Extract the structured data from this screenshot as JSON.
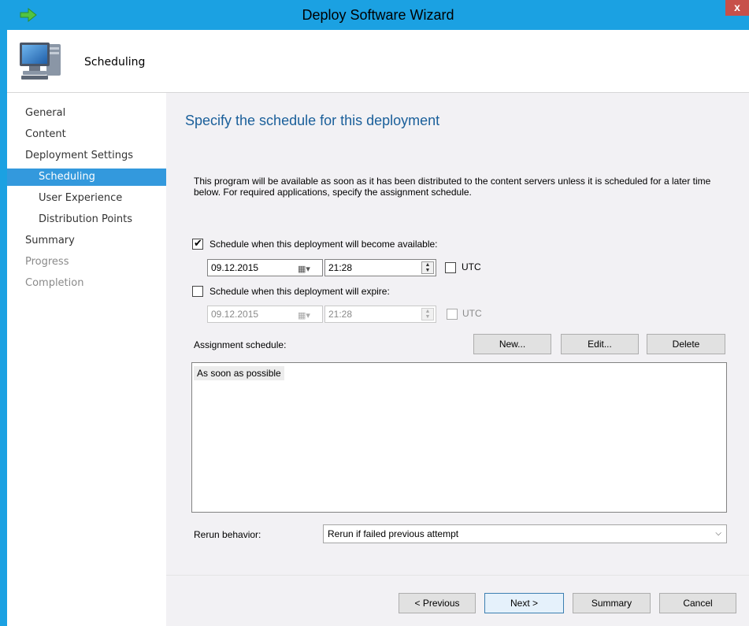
{
  "window": {
    "title": "Deploy Software Wizard",
    "close_label": "x"
  },
  "header": {
    "page_title": "Scheduling"
  },
  "nav": {
    "items": [
      {
        "label": "General"
      },
      {
        "label": "Content"
      },
      {
        "label": "Deployment Settings"
      },
      {
        "label": "Scheduling"
      },
      {
        "label": "User Experience"
      },
      {
        "label": "Distribution Points"
      },
      {
        "label": "Summary"
      },
      {
        "label": "Progress"
      },
      {
        "label": "Completion"
      }
    ]
  },
  "main": {
    "heading": "Specify the schedule for this deployment",
    "description": "This program will be available as soon as it has been distributed to the content servers unless it is scheduled for a later time below. For required applications, specify the assignment schedule.",
    "available": {
      "label": "Schedule when this deployment will become available:",
      "checked": true,
      "date": "09.12.2015",
      "time": "21:28",
      "utc_label": "UTC"
    },
    "expire": {
      "label": "Schedule when this deployment will expire:",
      "checked": false,
      "date": "09.12.2015",
      "time": "21:28",
      "utc_label": "UTC"
    },
    "assignment": {
      "label": "Assignment schedule:",
      "new_label": "New...",
      "edit_label": "Edit...",
      "delete_label": "Delete",
      "items": [
        "As soon as possible"
      ]
    },
    "rerun": {
      "label": "Rerun behavior:",
      "value": "Rerun if failed previous attempt"
    }
  },
  "footer": {
    "previous_label": "< Previous",
    "next_label": "Next >",
    "summary_label": "Summary",
    "cancel_label": "Cancel"
  },
  "colors": {
    "title_bar": "#1ba1e2",
    "nav_active": "#3399dd",
    "heading": "#1a5f9a",
    "content_bg": "#f2f1f4"
  },
  "icons": {
    "app": "green-arrow-icon",
    "wizard": "computer-monitor-icon",
    "close": "close-icon",
    "calendar": "calendar-dropdown-icon",
    "spinner": "spinner-icon",
    "dropdown": "chevron-down-icon"
  }
}
